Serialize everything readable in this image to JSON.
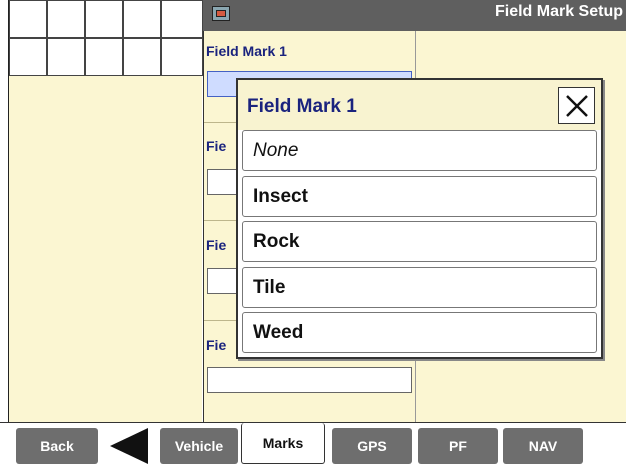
{
  "header": {
    "title": "Field Mark Setup",
    "icon": "display-icon"
  },
  "main": {
    "sections": [
      {
        "label": "Field Mark 1"
      },
      {
        "label": "Fie"
      },
      {
        "label": "Fie"
      },
      {
        "label": "Fie"
      }
    ]
  },
  "popup": {
    "title": "Field Mark 1",
    "close_icon": "close-icon",
    "options": [
      {
        "label": "None"
      },
      {
        "label": "Insect"
      },
      {
        "label": "Rock"
      },
      {
        "label": "Tile"
      },
      {
        "label": "Weed"
      }
    ]
  },
  "bottom_nav": {
    "back_label": "Back",
    "back_arrow_icon": "left-arrow-icon",
    "tabs": [
      {
        "label": "Vehicle"
      },
      {
        "label": "Marks"
      },
      {
        "label": "GPS"
      },
      {
        "label": "PF"
      },
      {
        "label": "NAV"
      }
    ]
  },
  "colors": {
    "panel_background": "#fbf6d2",
    "header_background": "#5f5f5f",
    "label_text": "#1a237e",
    "selected_field": "#cfdcff",
    "tab_background": "#6e6e6e"
  }
}
